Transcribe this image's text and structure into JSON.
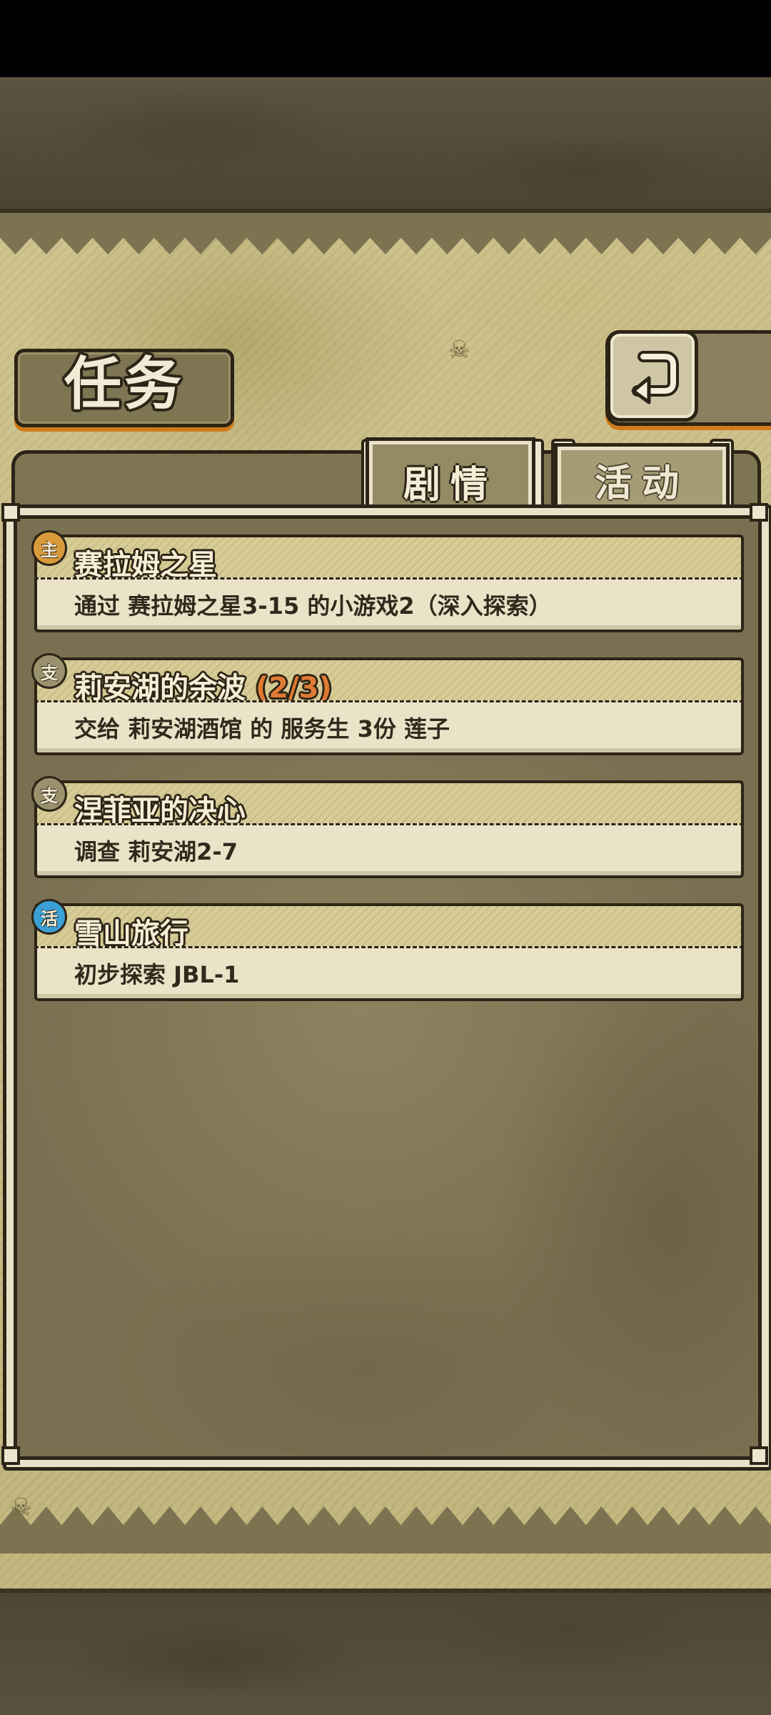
{
  "screen": {
    "title": "任务",
    "tabs": [
      {
        "label": "剧情",
        "active": true
      },
      {
        "label": "活动",
        "active": false
      }
    ],
    "back_icon": "return-arrow-icon"
  },
  "quests": [
    {
      "badge": "主",
      "badge_type": "main",
      "title": "赛拉姆之星",
      "progress": "",
      "description": "通过 赛拉姆之星3-15 的小游戏2（深入探索）"
    },
    {
      "badge": "支",
      "badge_type": "side",
      "title": "莉安湖的余波",
      "progress": "(2/3)",
      "description": "交给 莉安湖酒馆 的 服务生 3份 莲子"
    },
    {
      "badge": "支",
      "badge_type": "side",
      "title": "涅菲亚的决心",
      "progress": "",
      "description": "调查 莉安湖2-7"
    },
    {
      "badge": "活",
      "badge_type": "event",
      "title": "雪山旅行",
      "progress": "",
      "description": "初步探索 JBL-1"
    }
  ],
  "colors": {
    "frame_dark": "#2c2416",
    "parchment": "#ebe3c8",
    "accent_orange": "#d07a1c",
    "progress_orange": "#e07a33"
  }
}
